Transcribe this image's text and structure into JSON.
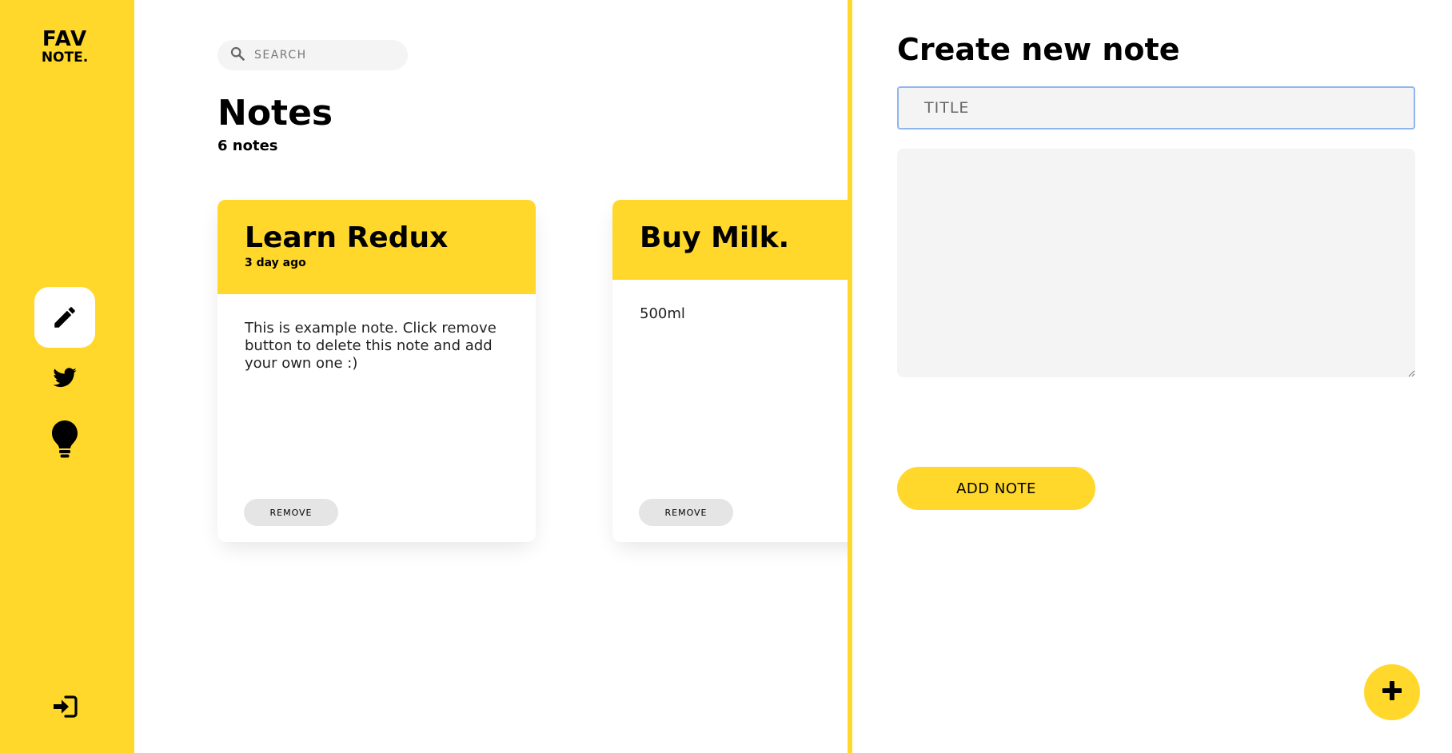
{
  "app": {
    "logo_line1": "FAV",
    "logo_line2": "NOTE."
  },
  "sidebar": {
    "items": [
      {
        "icon": "pencil-icon",
        "active": true
      },
      {
        "icon": "twitter-icon",
        "active": false
      },
      {
        "icon": "lightbulb-icon",
        "active": false
      }
    ],
    "logout_icon": "logout-icon"
  },
  "search": {
    "placeholder": "SEARCH",
    "value": ""
  },
  "notes_page": {
    "title": "Notes",
    "count_label": "6 notes"
  },
  "notes": [
    {
      "title": "Learn Redux",
      "date": "3 day ago",
      "content": "This is example note. Click remove button to delete this note and add your own one :)",
      "remove_label": "REMOVE"
    },
    {
      "title": "Buy Milk.",
      "date": "",
      "content": "500ml",
      "remove_label": "REMOVE"
    }
  ],
  "new_note_panel": {
    "heading": "Create new note",
    "title_placeholder": "TITLE",
    "title_value": "",
    "content_value": "",
    "submit_label": "ADD NOTE"
  },
  "fab": {
    "icon": "plus-icon"
  },
  "colors": {
    "accent": "#ffd82b",
    "input_bg": "#f4f4f4",
    "remove_bg": "#e5e5e5",
    "focus_border": "#8fb6ef"
  }
}
